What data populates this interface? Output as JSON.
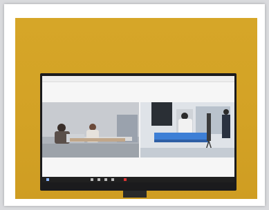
{
  "scene": {
    "description_tags": [
      "photo-frame",
      "wall",
      "tv-monitor",
      "video-conference"
    ],
    "colors": {
      "wall": "#d3a225",
      "frame": "#ffffff",
      "tv_bezel": "#1b1b1d",
      "screen_bg": "#f6f6f6"
    }
  }
}
